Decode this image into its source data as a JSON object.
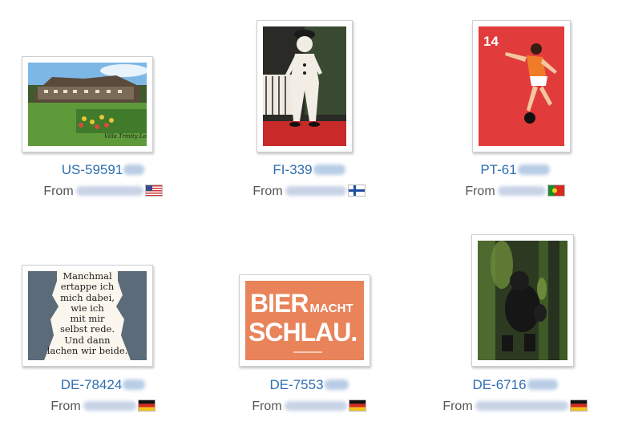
{
  "cards": [
    {
      "code_visible": "US-59591",
      "from_label": "From",
      "country": "United States",
      "flag_icon": "us-flag-icon"
    },
    {
      "code_visible": "FI-339",
      "from_label": "From",
      "country": "Finland",
      "flag_icon": "fi-flag-icon"
    },
    {
      "code_visible": "PT-61",
      "from_label": "From",
      "country": "Portugal",
      "flag_icon": "pt-flag-icon"
    },
    {
      "code_visible": "DE-78424",
      "from_label": "From",
      "country": "Germany",
      "flag_icon": "de-flag-icon"
    },
    {
      "code_visible": "DE-7553",
      "from_label": "From",
      "country": "Germany",
      "flag_icon": "de-flag-icon"
    },
    {
      "code_visible": "DE-6716",
      "from_label": "From",
      "country": "Germany",
      "flag_icon": "de-flag-icon"
    }
  ],
  "postcard_texts": {
    "us_caption": "Villa Trinity Lodge",
    "fi_caption": "",
    "pt_number": "14",
    "de1_poem": [
      "Manchmal",
      "ertappe ich",
      "mich dabei,",
      "wie ich",
      "mit mir",
      "selbst rede.",
      "Und dann",
      "lachen wir beide."
    ],
    "de2_line1": "BIER",
    "de2_line1_small": "MACHT",
    "de2_line2": "SCHLAU."
  },
  "colors": {
    "link": "#2f6fb3",
    "bier_orange": "#e8835a",
    "pt_red": "#e23b3b"
  }
}
